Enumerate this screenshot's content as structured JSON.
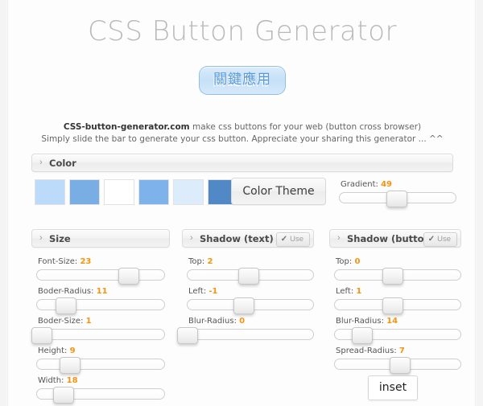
{
  "app": {
    "title": "CSS Button Generator"
  },
  "preview": {
    "button_label": "關鍵應用"
  },
  "description": {
    "line1_bold": "CSS-button-generator.com",
    "line1_rest": " make css buttons for your web (button cross browser)",
    "line2": "Simply slide the bar to generate your css button. Appreciate your sharing this generator ... ^^"
  },
  "color_section": {
    "header": "Color",
    "chevron": "›",
    "swatches": [
      {
        "name": "swatch-1",
        "hex": "#bcdafa"
      },
      {
        "name": "swatch-2",
        "hex": "#79aee4"
      },
      {
        "name": "swatch-3",
        "hex": "#ffffff"
      },
      {
        "name": "swatch-4",
        "hex": "#7db3ea"
      },
      {
        "name": "swatch-5",
        "hex": "#ddecfb"
      },
      {
        "name": "swatch-6",
        "hex": "#5089c6"
      }
    ],
    "theme_button": "Color Theme",
    "gradient": {
      "label": "Gradient:",
      "value": "49",
      "percent": 49
    }
  },
  "size_section": {
    "header": "Size",
    "chevron": "›",
    "controls": [
      {
        "label": "Font-Size:",
        "value": "23",
        "percent": 72
      },
      {
        "label": "Boder-Radius:",
        "value": "11",
        "percent": 23
      },
      {
        "label": "Boder-Size:",
        "value": "1",
        "percent": 4
      },
      {
        "label": "Height:",
        "value": "9",
        "percent": 26
      },
      {
        "label": "Width:",
        "value": "18",
        "percent": 21
      }
    ]
  },
  "shadow_text_section": {
    "header": "Shadow (text)",
    "chevron": "›",
    "use_label": "Use",
    "use_check": "✓",
    "use_enabled": true,
    "controls": [
      {
        "label": "Top:",
        "value": "2",
        "percent": 49
      },
      {
        "label": "Left:",
        "value": "-1",
        "percent": 45
      },
      {
        "label": "Blur-Radius:",
        "value": "0",
        "percent": 0
      }
    ]
  },
  "shadow_button_section": {
    "header": "Shadow (button)",
    "chevron": "›",
    "use_label": "Use",
    "use_check": "✓",
    "use_enabled": true,
    "controls": [
      {
        "label": "Top:",
        "value": "0",
        "percent": 46
      },
      {
        "label": "Left:",
        "value": "1",
        "percent": 46
      },
      {
        "label": "Blur-Radius:",
        "value": "14",
        "percent": 22
      },
      {
        "label": "Spread-Radius:",
        "value": "7",
        "percent": 52
      }
    ]
  },
  "inset_button": {
    "label": "inset"
  },
  "colors": {
    "accent_value": "#f59410",
    "title_gray": "#b9b9b9",
    "preview_blue": "#5b9bd8"
  }
}
